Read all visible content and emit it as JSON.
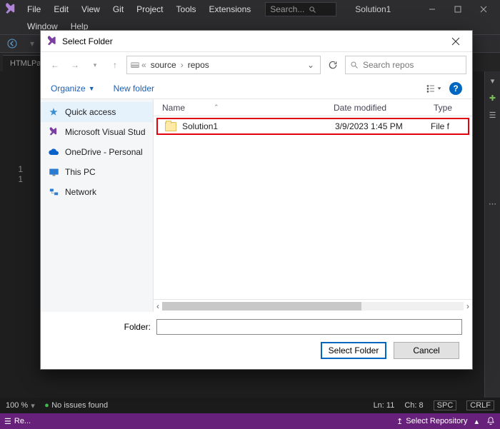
{
  "vs": {
    "menu": [
      "File",
      "Edit",
      "View",
      "Git",
      "Project",
      "Tools",
      "Extensions"
    ],
    "menu2": [
      "Window",
      "Help"
    ],
    "search_placeholder": "Search...",
    "solution": "Solution1",
    "tab": "HTMLPa",
    "gutter": [
      "1",
      "1"
    ],
    "status": {
      "zoom": "100 %",
      "issues": "No issues found",
      "ln": "Ln: 11",
      "ch": "Ch: 8",
      "spc": "SPC",
      "crlf": "CRLF",
      "ready": "Re...",
      "repo": "Select Repository"
    }
  },
  "dialog": {
    "title": "Select Folder",
    "breadcrumb": [
      "source",
      "repos"
    ],
    "search_placeholder": "Search repos",
    "toolbar": {
      "organize": "Organize",
      "newfolder": "New folder"
    },
    "columns": {
      "name": "Name",
      "date": "Date modified",
      "type": "Type"
    },
    "rows": [
      {
        "name": "Solution1",
        "date": "3/9/2023 1:45 PM",
        "type": "File f"
      }
    ],
    "folder_label": "Folder:",
    "folder_value": "",
    "buttons": {
      "select": "Select Folder",
      "cancel": "Cancel"
    },
    "side": [
      "Quick access",
      "Microsoft Visual Stud",
      "OneDrive - Personal",
      "This PC",
      "Network"
    ]
  }
}
